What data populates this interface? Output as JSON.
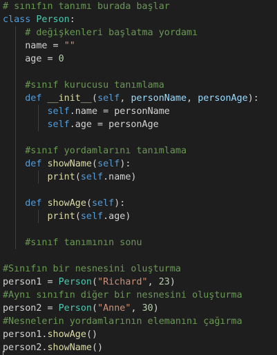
{
  "code": {
    "l1_comment": "# sınıfın tanımı burada başlar",
    "l2_kw": "class",
    "l2_name": "Person",
    "l2_colon": ":",
    "l3_comment": "# değişkenleri başlatma yordamı",
    "l4_var": "name = ",
    "l4_str": "\"\"",
    "l5_var": "age = ",
    "l5_num": "0",
    "l7_comment": "#sınıf kurucusu tanımlama",
    "l8_kw": "def",
    "l8_fn": "__init__",
    "l8_open": "(",
    "l8_p1": "self",
    "l8_sep1": ", ",
    "l8_p2": "personName",
    "l8_sep2": ", ",
    "l8_p3": "personAge",
    "l8_close": "):",
    "l9_self": "self",
    "l9_rest": ".name = personName",
    "l10_self": "self",
    "l10_rest": ".age = personAge",
    "l12_comment": "#sınıf yordamlarını tanımlama",
    "l13_kw": "def",
    "l13_fn": "showName",
    "l13_open": "(",
    "l13_p": "self",
    "l13_close": "):",
    "l14_fn": "print",
    "l14_open": "(",
    "l14_self": "self",
    "l14_rest": ".name)",
    "l16_kw": "def",
    "l16_fn": "showAge",
    "l16_open": "(",
    "l16_p": "self",
    "l16_close": "):",
    "l17_fn": "print",
    "l17_open": "(",
    "l17_self": "self",
    "l17_rest": ".age)",
    "l19_comment": "#sınıf tanımının sonu",
    "l21_comment": "#Sınıfın bir nesnesini oluşturma",
    "l22_a": "person1 = ",
    "l22_cls": "Person",
    "l22_open": "(",
    "l22_str": "\"Richard\"",
    "l22_sep": ", ",
    "l22_num": "23",
    "l22_close": ")",
    "l23_comment": "#Aynı sınıfın diğer bir nesnesini oluşturma",
    "l24_a": "person2 = ",
    "l24_cls": "Person",
    "l24_open": "(",
    "l24_str": "\"Anne\"",
    "l24_sep": ", ",
    "l24_num": "30",
    "l24_close": ")",
    "l25_comment": "#Nesnelerin yordamlarının elemanını çağırma",
    "l26_a": "person1.",
    "l26_fn": "showAge",
    "l26_close": "()",
    "l27_a": "person2.",
    "l27_fn": "showName",
    "l27_close": "()"
  }
}
